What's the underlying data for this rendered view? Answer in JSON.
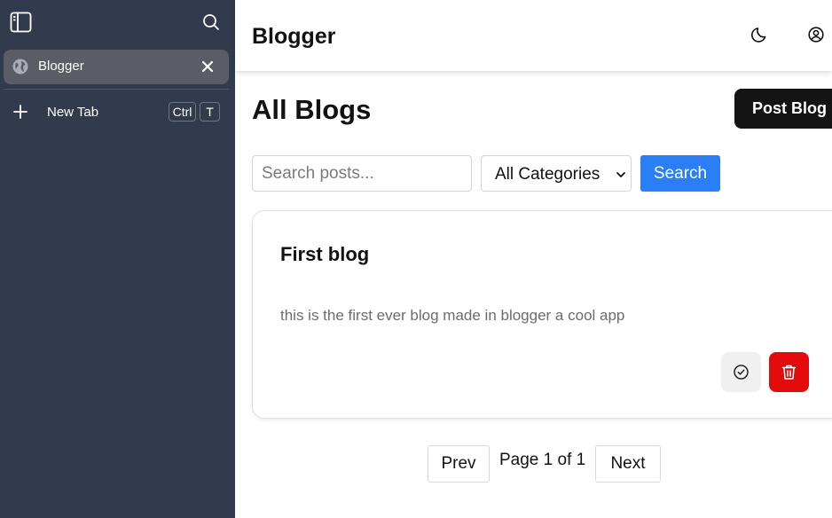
{
  "sidebar": {
    "toggle_icon": "sidebar-panel-icon",
    "search_icon": "search-icon",
    "tabs": [
      {
        "label": "Blogger",
        "icon": "globe-icon",
        "active": true
      }
    ],
    "new_tab": {
      "label": "New Tab",
      "shortcut_ctrl": "Ctrl",
      "shortcut_key": "T"
    }
  },
  "header": {
    "title": "Blogger",
    "theme_icon": "moon-icon",
    "account_icon": "user-circle-icon"
  },
  "main": {
    "page_title": "All Blogs",
    "post_button": "Post Blog",
    "search": {
      "placeholder": "Search posts...",
      "value": ""
    },
    "category_select": {
      "selected": "All Categories"
    },
    "search_button": "Search",
    "posts": [
      {
        "title": "First blog",
        "body": "this is the first ever blog made in blogger a cool app"
      }
    ],
    "pagination": {
      "prev": "Prev",
      "info": "Page 1 of 1",
      "next": "Next"
    }
  },
  "colors": {
    "sidebar_bg": "#323b4e",
    "active_tab_bg": "#5a5d66",
    "primary_button": "#2b7ff6",
    "danger_button": "#e20a0a",
    "dark_button": "#141414"
  }
}
